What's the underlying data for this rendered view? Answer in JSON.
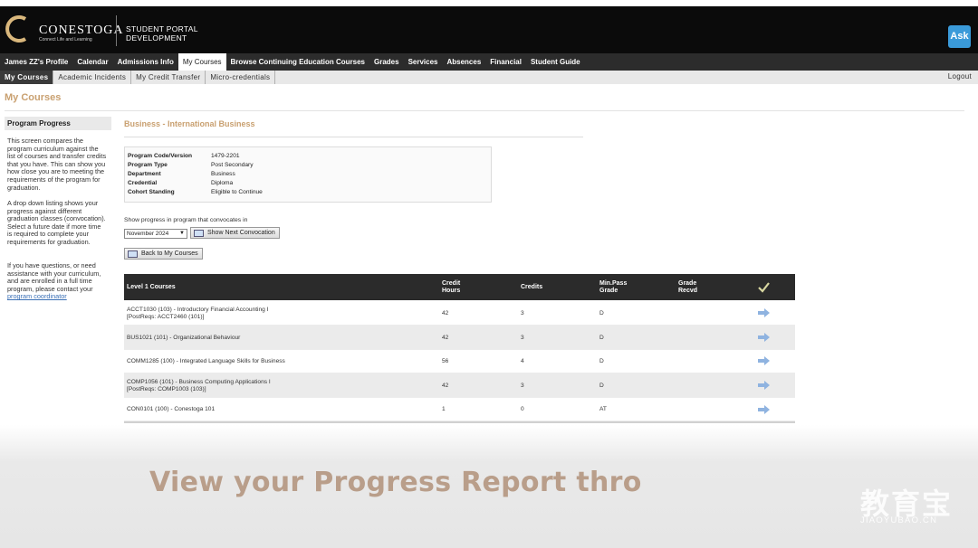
{
  "header": {
    "logo_text": "CONESTOGA",
    "logo_tagline": "Connect Life and Learning",
    "portal_title_line1": "STUDENT PORTAL",
    "portal_title_line2": "DEVELOPMENT",
    "ask_label": "Ask"
  },
  "nav": {
    "items": [
      {
        "label": "James ZZ's Profile"
      },
      {
        "label": "Calendar"
      },
      {
        "label": "Admissions Info"
      },
      {
        "label": "My Courses"
      },
      {
        "label": "Browse Continuing Education Courses"
      },
      {
        "label": "Grades"
      },
      {
        "label": "Services"
      },
      {
        "label": "Absences"
      },
      {
        "label": "Financial"
      },
      {
        "label": "Student Guide"
      }
    ]
  },
  "subnav": {
    "items": [
      {
        "label": "My Courses"
      },
      {
        "label": "Academic Incidents"
      },
      {
        "label": "My Credit Transfer"
      },
      {
        "label": "Micro-credentials"
      }
    ],
    "logout": "Logout"
  },
  "page": {
    "title": "My Courses"
  },
  "sidebar": {
    "heading": "Program Progress",
    "para1": "This screen compares the program curriculum against the list of courses and transfer credits that you have. This can show you how close you are to meeting the requirements of the program for graduation.",
    "para2": "A drop down listing shows your progress against different graduation classes (convocation). Select a future date if more time is required to complete your requirements for graduation.",
    "para3": "If you have questions, or need assistance with your curriculum, and are enrolled in a full time program, please contact your",
    "link": "program coordinator"
  },
  "program": {
    "title": "Business - International Business",
    "details": [
      {
        "label": "Program Code/Version",
        "value": "1479-2201"
      },
      {
        "label": "Program Type",
        "value": "Post Secondary"
      },
      {
        "label": "Department",
        "value": "Business"
      },
      {
        "label": "Credential",
        "value": "Diploma"
      },
      {
        "label": "Cohort Standing",
        "value": "Eligible to Continue"
      }
    ],
    "convocation_label": "Show progress in program that convocates in",
    "convocation_selected": "November 2024",
    "next_convocation_button": "Show Next Convocation",
    "back_button": "Back to My Courses"
  },
  "courses_table": {
    "headers": {
      "course": "Level 1 Courses",
      "hours_line1": "Credit",
      "hours_line2": "Hours",
      "credits": "Credits",
      "minpass_line1": "Min.Pass",
      "minpass_line2": "Grade",
      "grade_line1": "Grade",
      "grade_line2": "Recvd"
    },
    "rows": [
      {
        "course": "ACCT1030 (103) - Introductory Financial Accounting I",
        "postreq": "[PostReqs:  ACCT2460 (101)]",
        "hours": "42",
        "credits": "3",
        "min_pass": "D",
        "grade": ""
      },
      {
        "course": "BUS1021 (101) - Organizational Behaviour",
        "postreq": "",
        "hours": "42",
        "credits": "3",
        "min_pass": "D",
        "grade": ""
      },
      {
        "course": "COMM1285 (100) - Integrated Language Skills for Business",
        "postreq": "",
        "hours": "56",
        "credits": "4",
        "min_pass": "D",
        "grade": ""
      },
      {
        "course": "COMP1056 (101) - Business Computing Applications I",
        "postreq": "[PostReqs:  COMP1003 (103)]",
        "hours": "42",
        "credits": "3",
        "min_pass": "D",
        "grade": ""
      },
      {
        "course": "CON0101 (100) - Conestoga 101",
        "postreq": "",
        "hours": "1",
        "credits": "0",
        "min_pass": "AT",
        "grade": ""
      }
    ]
  },
  "caption": "View your Progress Report thro",
  "watermark": {
    "cn": "教育宝",
    "url": "JIAOYUBAO.CN"
  },
  "colors": {
    "accent_gold": "#c9a070",
    "header_black": "#0b0b0b",
    "nav_dark": "#2c2c2c",
    "link_blue": "#3a6fb5",
    "ask_blue": "#3a9ad9"
  }
}
